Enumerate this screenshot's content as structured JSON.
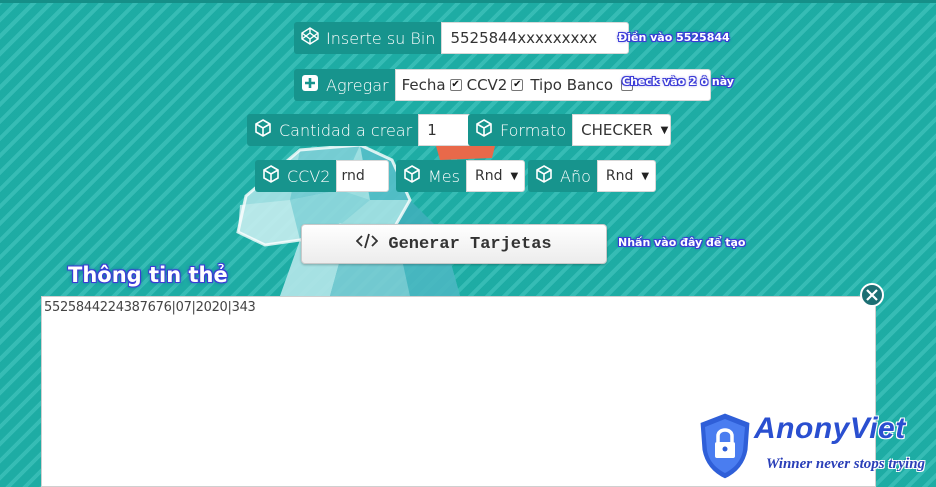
{
  "form": {
    "bin": {
      "label": "Inserte su Bin",
      "value": "5525844xxxxxxxxx"
    },
    "agregar": {
      "label": "Agregar",
      "options": [
        {
          "label": "Fecha",
          "checked": true
        },
        {
          "label": "CCV2",
          "checked": true
        },
        {
          "label": "Tipo Banco",
          "checked": false
        }
      ]
    },
    "cantidad": {
      "label": "Cantidad a crear",
      "value": "1"
    },
    "formato": {
      "label": "Formato",
      "selected": "CHECKER"
    },
    "ccv2": {
      "label": "CCV2",
      "value": "rnd"
    },
    "mes": {
      "label": "Mes",
      "selected": "Rnd"
    },
    "anio": {
      "label": "Año",
      "selected": "Rnd"
    },
    "generate_button": {
      "label": "Generar Tarjetas"
    }
  },
  "annotations": {
    "bin_note": "Điền vào 5525844",
    "check_note": "Check vào 2 ô này",
    "generate_note": "Nhấn vào đây để tạo",
    "heading": "Thông tin thẻ"
  },
  "output": {
    "text": "5525844224387676|07|2020|343"
  },
  "watermark": {
    "name": "AnonyViet",
    "tagline": "Winner never stops trying"
  },
  "colors": {
    "background": "#1fb5ad",
    "addon": "#17948d",
    "annotation_outline": "#3b3bd8",
    "brand": "#2a4fd0"
  },
  "icons": [
    "codepen-icon",
    "plus-square-icon",
    "cube-icon",
    "code-icon",
    "close-icon",
    "shield-lock-icon"
  ]
}
